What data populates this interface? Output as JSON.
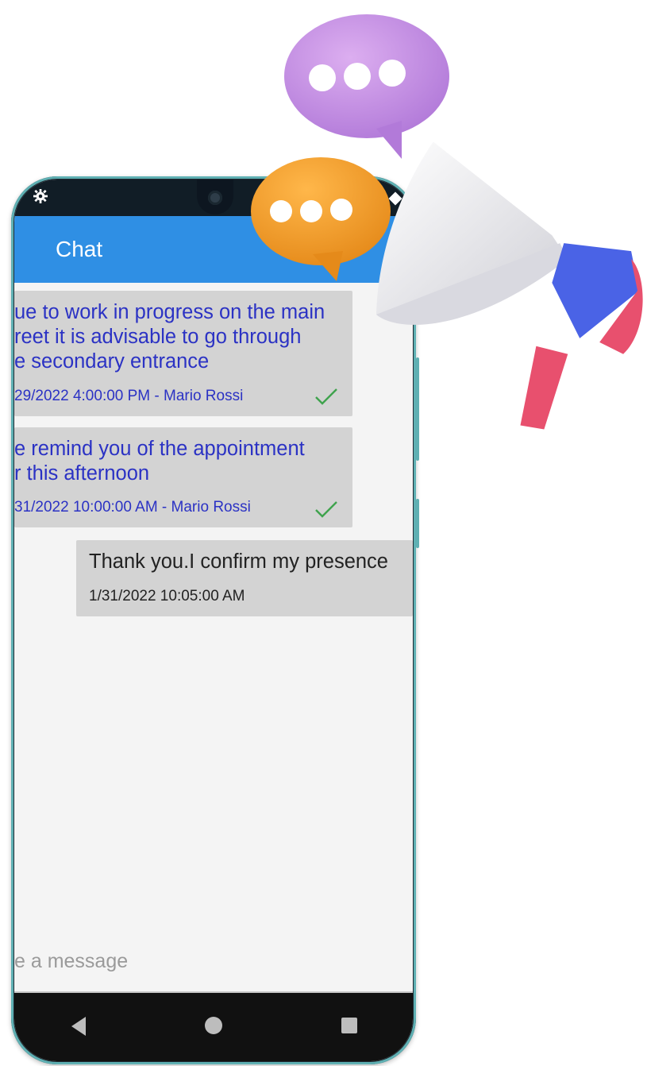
{
  "app": {
    "title": "Chat"
  },
  "messages": [
    {
      "lines": [
        "ue to work in progress on the main",
        "reet it is advisable to go through",
        "e secondary entrance"
      ],
      "meta": "29/2022 4:00:00 PM - Mario Rossi",
      "status": "sent"
    },
    {
      "lines": [
        "e remind you of the appointment",
        "r this afternoon"
      ],
      "meta": "31/2022 10:00:00 AM - Mario Rossi",
      "status": "sent"
    },
    {
      "lines": [
        "Thank you.I confirm my presence"
      ],
      "meta": "1/31/2022 10:05:00 AM",
      "own": true
    }
  ],
  "composer": {
    "placeholder": "e a message"
  },
  "colors": {
    "appbar": "#2f8fe4",
    "bubble": "#d3d3d3",
    "incoming_text": "#2b32c4",
    "check": "#3fa34d"
  },
  "icons": [
    "gear-icon",
    "camera-icon",
    "check-icon",
    "back-icon",
    "home-icon",
    "recent-apps-icon",
    "speech-bubble-icon",
    "megaphone-icon"
  ]
}
